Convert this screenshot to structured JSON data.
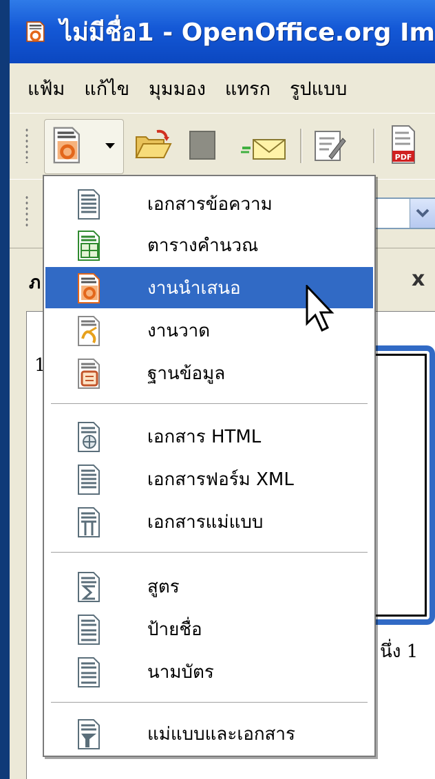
{
  "window": {
    "title": "ไม่มีชื่อ1 - OpenOffice.org Im"
  },
  "menubar": {
    "items": [
      {
        "label": "แฟ้ม"
      },
      {
        "label": "แก้ไข"
      },
      {
        "label": "มุมมอง"
      },
      {
        "label": "แทรก"
      },
      {
        "label": "รูปแบบ"
      }
    ]
  },
  "toolbar": {
    "buttons": [
      {
        "icon": "new-presentation-icon"
      },
      {
        "icon": "dropdown-arrow-icon"
      },
      {
        "icon": "open-folder-icon"
      },
      {
        "icon": "save-icon"
      },
      {
        "icon": "email-icon"
      },
      {
        "icon": "edit-file-icon"
      },
      {
        "icon": "export-pdf-icon"
      }
    ]
  },
  "side_pane": {
    "title": "ภ",
    "close_label": "x",
    "slide_number": "1",
    "slide_label": "นึ่ง 1"
  },
  "new_menu": {
    "groups": [
      [
        {
          "label": "เอกสารข้อความ",
          "icon": "text-document-icon",
          "color": "#5a6e7a"
        },
        {
          "label": "ตารางคำนวณ",
          "icon": "spreadsheet-icon",
          "color": "#2f8a2f"
        },
        {
          "label": "งานนำเสนอ",
          "icon": "presentation-icon",
          "color": "#e3671b",
          "selected": true
        },
        {
          "label": "งานวาด",
          "icon": "drawing-icon",
          "color": "#e7a11c"
        },
        {
          "label": "ฐานข้อมูล",
          "icon": "database-icon",
          "color": "#c2552a"
        }
      ],
      [
        {
          "label": "เอกสาร HTML",
          "icon": "html-document-icon",
          "color": "#5a6e7a"
        },
        {
          "label": "เอกสารฟอร์ม XML",
          "icon": "xml-form-icon",
          "color": "#5a6e7a"
        },
        {
          "label": "เอกสารแม่แบบ",
          "icon": "master-document-icon",
          "color": "#5a6e7a"
        }
      ],
      [
        {
          "label": "สูตร",
          "icon": "formula-icon",
          "color": "#5a6e7a"
        },
        {
          "label": "ป้ายชื่อ",
          "icon": "labels-icon",
          "color": "#5a6e7a"
        },
        {
          "label": "นามบัตร",
          "icon": "business-card-icon",
          "color": "#5a6e7a"
        }
      ],
      [
        {
          "label": "แม่แบบและเอกสาร",
          "icon": "templates-icon",
          "color": "#5a6e7a"
        }
      ]
    ]
  },
  "colors": {
    "titlebar": "#1458d6",
    "menu_highlight": "#316ac5",
    "chrome": "#ece9d8"
  }
}
